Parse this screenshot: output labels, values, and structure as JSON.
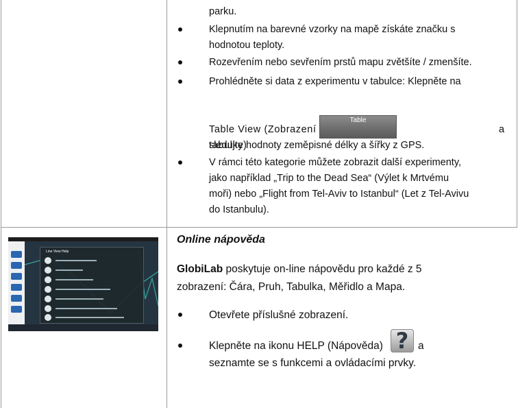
{
  "top_cell": {
    "line0": "parku.",
    "bullets": [
      [
        "Klepnutím na barevné vzorky na mapě získáte značku s",
        "hodnotou teploty."
      ],
      [
        "Rozevřením nebo sevřením prstů mapu zvětšíte / zmenšíte."
      ],
      [
        "Prohlédněte si data z experimentu v tabulce: Klepněte na"
      ],
      [
        "V rámci této kategorie můžete zobrazit další experimenty,",
        "jako například „Trip to the Dead Sea“ (Výlet k Mrtvému",
        "moři) nebo „Flight from Tel-Aviv to Istanbul“ (Let z Tel-Avivu",
        "do Istanbulu)."
      ]
    ],
    "table_line": "Table View (Zobrazení tabulky)",
    "table_line_a": "a",
    "table_button": "Table",
    "table_after": "sledujte hodnoty zeměpisné délky a šířky z GPS."
  },
  "bottom_cell": {
    "heading": "Online nápověda",
    "intro_bold": "GlobiLab",
    "intro_rest": " poskytuje on-line nápovědu pro každé z 5",
    "intro_line2": "zobrazení: Čára, Pruh, Tabulka, Měřidlo a Mapa.",
    "bullet1": "Otevřete příslušné zobrazení.",
    "bullet2_a": "Klepněte na ikonu HELP (Nápověda)",
    "bullet2_b": "a",
    "bullet2_line2": "seznamte se s funkcemi a ovládacími prvky.",
    "help_glyph": "?"
  },
  "thumbnail": {
    "panel_title": "Line View Help"
  }
}
